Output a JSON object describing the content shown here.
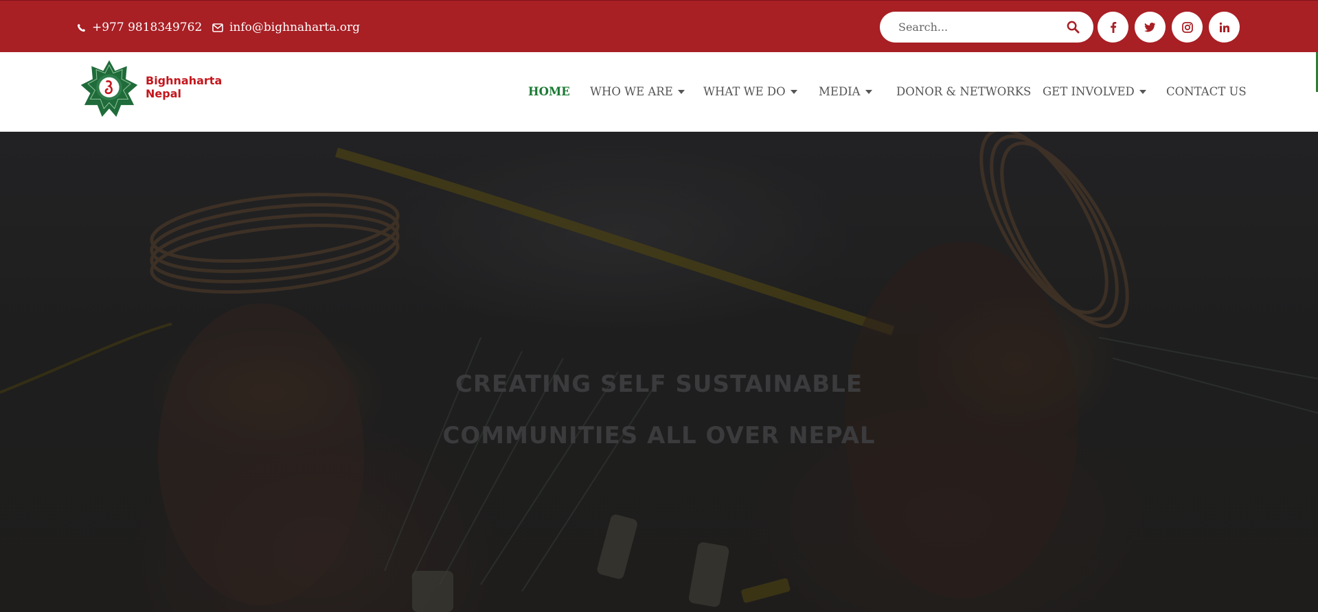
{
  "topbar": {
    "phone": "+977 9818349762",
    "email": "info@bighnaharta.org",
    "search_placeholder": "Search...",
    "social": [
      {
        "icon": "facebook-icon",
        "glyph": "f"
      },
      {
        "icon": "twitter-icon",
        "glyph": "t"
      },
      {
        "icon": "instagram-icon",
        "glyph": "ig"
      },
      {
        "icon": "linkedin-icon",
        "glyph": "in"
      }
    ],
    "colors": {
      "bar": "#a81f24",
      "accent": "#c4161c"
    }
  },
  "header": {
    "logo_text_line1": "Bighnaharta",
    "logo_text_line2": "Nepal",
    "nav": [
      {
        "label": "HOME",
        "active": true,
        "dropdown": false
      },
      {
        "label": "WHO WE ARE",
        "active": false,
        "dropdown": true
      },
      {
        "label": "WHAT WE DO",
        "active": false,
        "dropdown": true
      },
      {
        "label": "MEDIA",
        "active": false,
        "dropdown": true
      },
      {
        "label": "DONOR & NETWORKS",
        "active": false,
        "dropdown": false
      },
      {
        "label": "GET INVOLVED",
        "active": false,
        "dropdown": true
      },
      {
        "label": "CONTACT US",
        "active": false,
        "dropdown": false
      }
    ],
    "colors": {
      "active": "#1b7a34",
      "link": "#555555"
    }
  },
  "hero": {
    "title_line1": "CREATING SELF SUSTAINABLE",
    "title_line2": "COMMUNITIES ALL OVER NEPAL"
  }
}
